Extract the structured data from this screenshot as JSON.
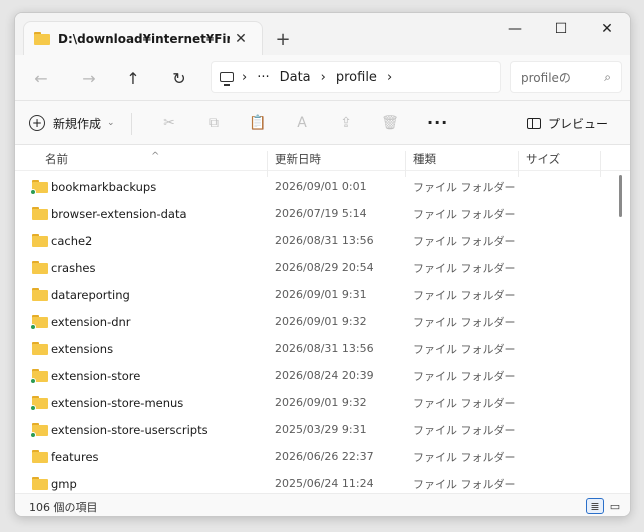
{
  "tab": {
    "title": "D:\\download¥internet¥Firefox",
    "close": "✕",
    "new": "+"
  },
  "window_controls": {
    "minimize": "—",
    "maximize": "☐",
    "close": "✕"
  },
  "nav": {
    "back": "←",
    "forward": "→",
    "up": "↑",
    "refresh": "↻"
  },
  "address": {
    "sep1": "›",
    "ellipsis": "···",
    "crumb1": "Data",
    "sep2": "›",
    "crumb2": "profile",
    "sep3": "›"
  },
  "search": {
    "placeholder": "profileの検索",
    "text": "profileの",
    "icon": "⌕"
  },
  "commands": {
    "new_label": "新規作成",
    "new_chevron": "⌄",
    "cut": "✂",
    "copy": "⧉",
    "paste": "📋",
    "rename": "A",
    "share": "⇪",
    "delete": "🗑",
    "more": "···",
    "preview_label": "プレビュー"
  },
  "columns": {
    "name": "名前",
    "modified": "更新日時",
    "type": "種類",
    "size": "サイズ",
    "sort_indicator": "^"
  },
  "rows": [
    {
      "name": "bookmarkbackups",
      "date": "2026/09/01 0:01",
      "type": "ファイル フォルダー",
      "synced": true
    },
    {
      "name": "browser-extension-data",
      "date": "2026/07/19 5:14",
      "type": "ファイル フォルダー",
      "synced": false
    },
    {
      "name": "cache2",
      "date": "2026/08/31 13:56",
      "type": "ファイル フォルダー",
      "synced": false
    },
    {
      "name": "crashes",
      "date": "2026/08/29 20:54",
      "type": "ファイル フォルダー",
      "synced": false
    },
    {
      "name": "datareporting",
      "date": "2026/09/01 9:31",
      "type": "ファイル フォルダー",
      "synced": false
    },
    {
      "name": "extension-dnr",
      "date": "2026/09/01 9:32",
      "type": "ファイル フォルダー",
      "synced": true
    },
    {
      "name": "extensions",
      "date": "2026/08/31 13:56",
      "type": "ファイル フォルダー",
      "synced": false
    },
    {
      "name": "extension-store",
      "date": "2026/08/24 20:39",
      "type": "ファイル フォルダー",
      "synced": true
    },
    {
      "name": "extension-store-menus",
      "date": "2026/09/01 9:32",
      "type": "ファイル フォルダー",
      "synced": true
    },
    {
      "name": "extension-store-userscripts",
      "date": "2025/03/29 9:31",
      "type": "ファイル フォルダー",
      "synced": true
    },
    {
      "name": "features",
      "date": "2026/06/26 22:37",
      "type": "ファイル フォルダー",
      "synced": false
    },
    {
      "name": "gmp",
      "date": "2025/06/24 11:24",
      "type": "ファイル フォルダー",
      "synced": false
    }
  ],
  "status": {
    "count": "106 個の項目",
    "details_icon": "≣",
    "tiles_icon": "▭"
  },
  "colors": {
    "folder": "#f6c94a",
    "folder_tab": "#e5ac28",
    "sync_dot": "#2b9b54",
    "accent": "#2a6fc9"
  }
}
